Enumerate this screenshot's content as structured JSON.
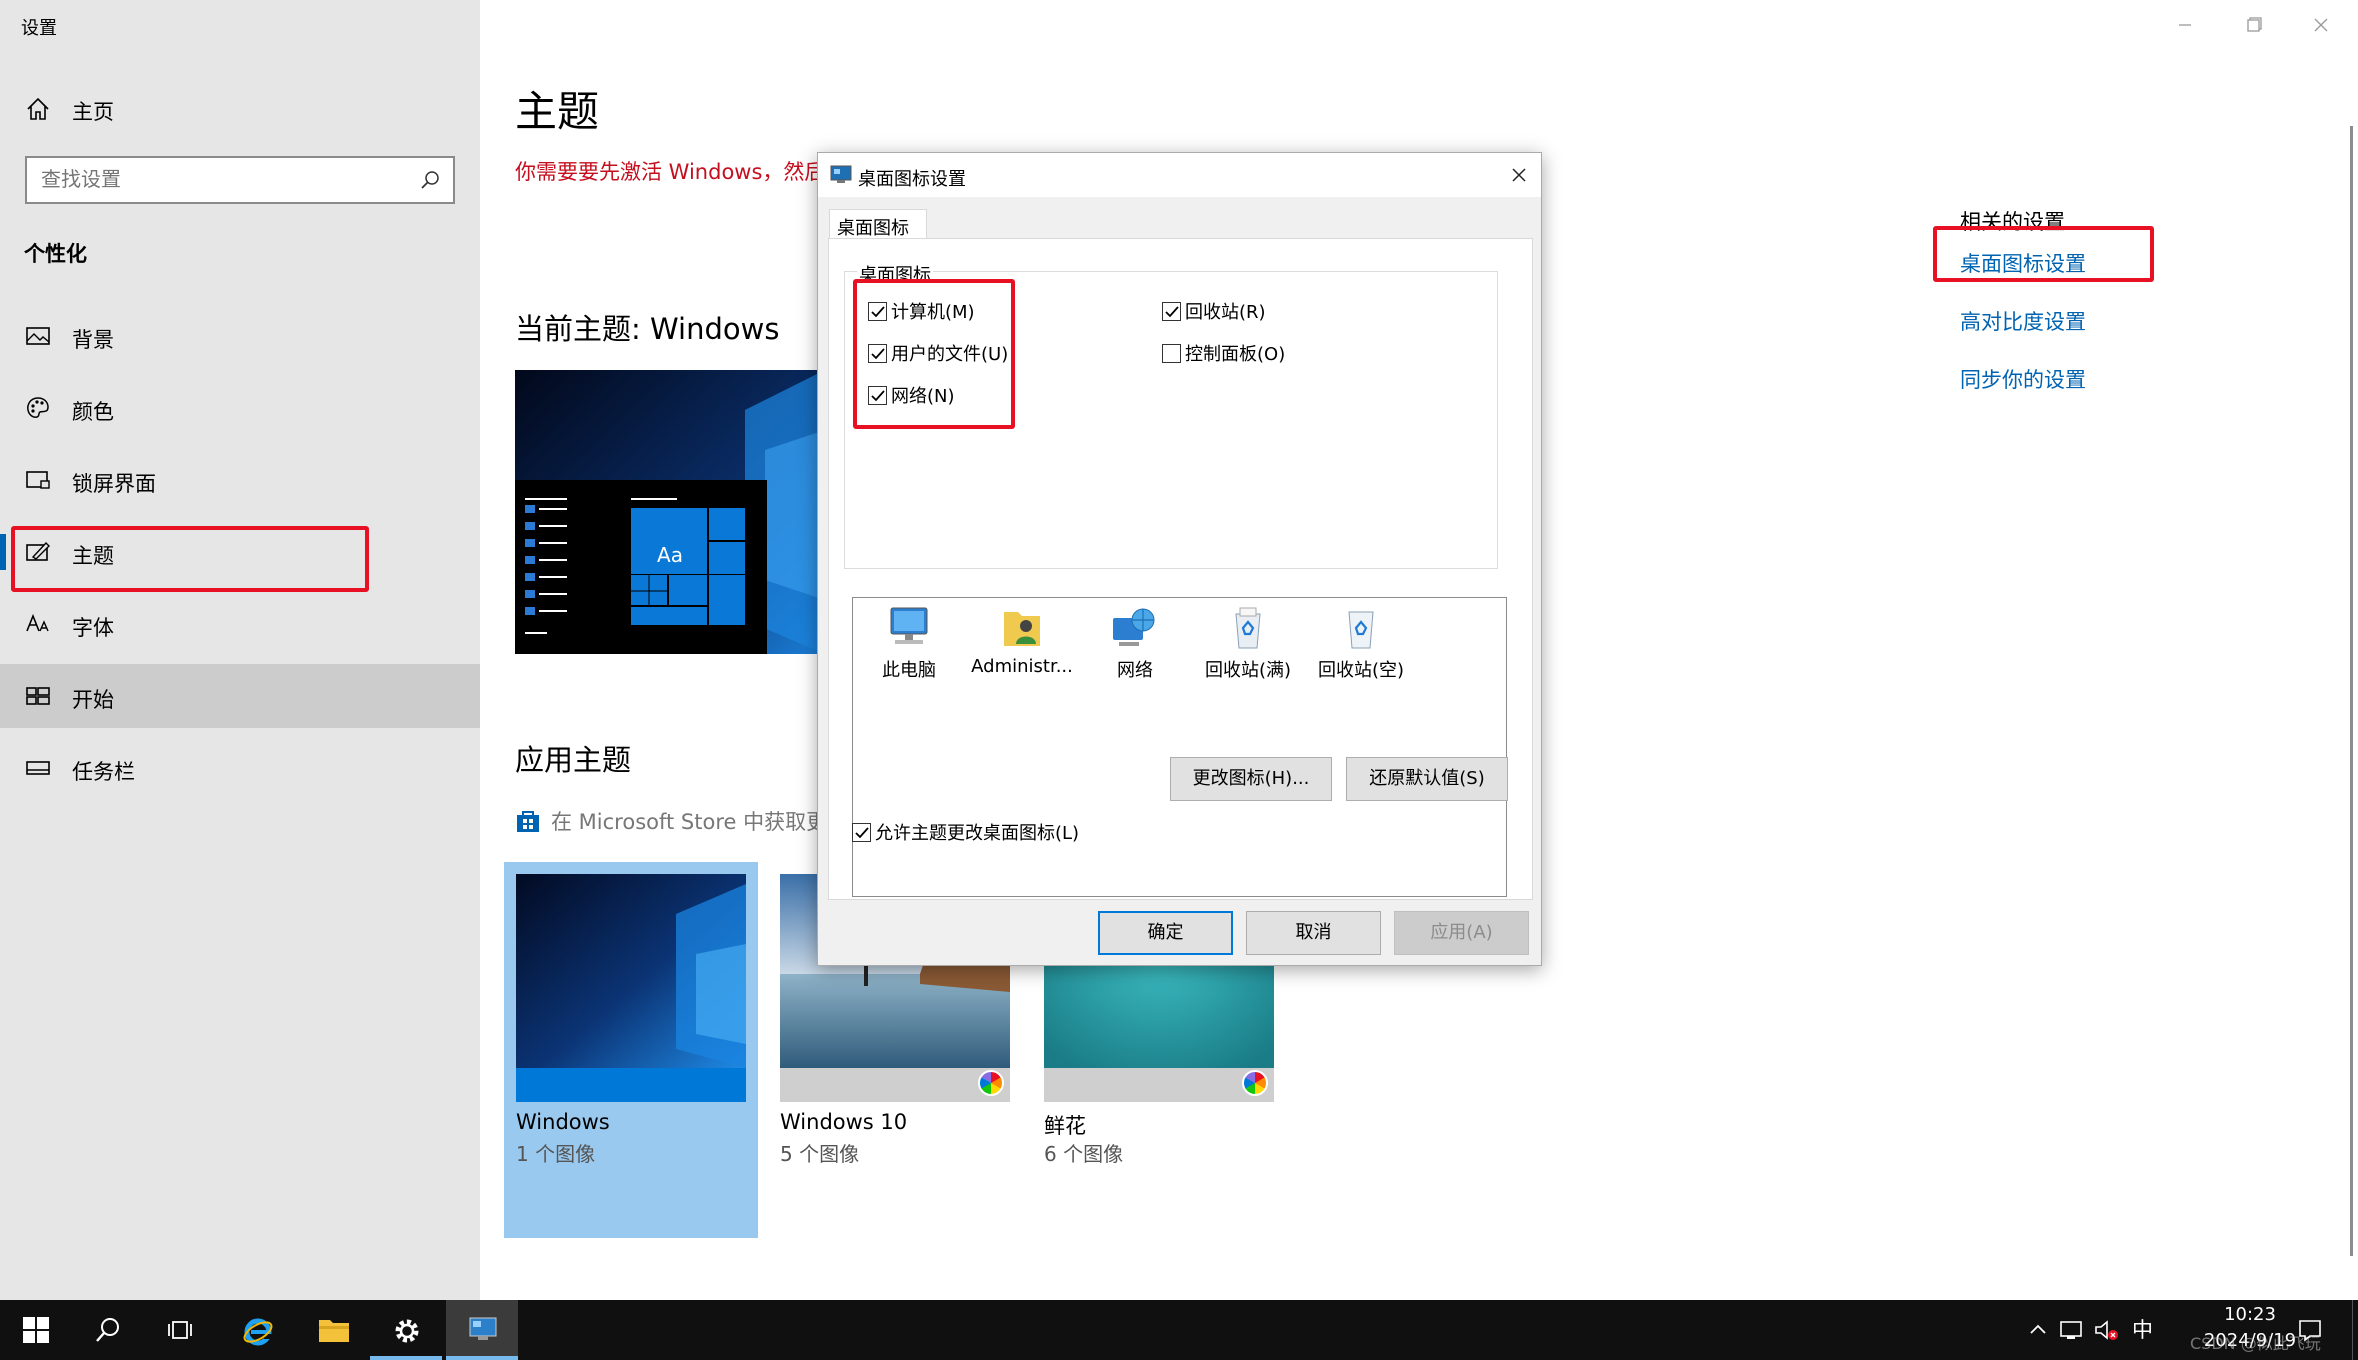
{
  "app": {
    "title": "设置"
  },
  "sidebar": {
    "home_label": "主页",
    "search_placeholder": "查找设置",
    "section_title": "个性化",
    "items": [
      {
        "label": "背景",
        "icon": "picture-icon"
      },
      {
        "label": "颜色",
        "icon": "palette-icon"
      },
      {
        "label": "锁屏界面",
        "icon": "lock-screen-icon"
      },
      {
        "label": "主题",
        "icon": "theme-brush-icon"
      },
      {
        "label": "字体",
        "icon": "font-icon"
      },
      {
        "label": "开始",
        "icon": "start-grid-icon"
      },
      {
        "label": "任务栏",
        "icon": "taskbar-icon"
      }
    ]
  },
  "main": {
    "title": "主题",
    "activation_msg": "你需要要先激活 Windows，然后才",
    "current_theme": "当前主题: Windows",
    "preview_text": "Aa",
    "apply_title": "应用主题",
    "store_link": "在 Microsoft Store 中获取更",
    "themes": [
      {
        "name": "Windows",
        "count": "1 个图像",
        "selected": true
      },
      {
        "name": "Windows 10",
        "count": "5 个图像",
        "selected": false
      },
      {
        "name": "鲜花",
        "count": "6 个图像",
        "selected": false
      }
    ]
  },
  "related": {
    "title": "相关的设置",
    "links": [
      "桌面图标设置",
      "高对比度设置",
      "同步你的设置"
    ]
  },
  "dialog": {
    "title": "桌面图标设置",
    "tab": "桌面图标",
    "group_label": "桌面图标",
    "checkboxes": [
      {
        "label": "计算机(M)",
        "checked": true
      },
      {
        "label": "用户的文件(U)",
        "checked": true
      },
      {
        "label": "网络(N)",
        "checked": true
      },
      {
        "label": "回收站(R)",
        "checked": true
      },
      {
        "label": "控制面板(O)",
        "checked": false
      }
    ],
    "icons": [
      "此电脑",
      "Administr...",
      "网络",
      "回收站(满)",
      "回收站(空)"
    ],
    "change_icon_button": "更改图标(H)...",
    "restore_default_button": "还原默认值(S)",
    "allow_themes_checkbox": {
      "label": "允许主题更改桌面图标(L)",
      "checked": true
    },
    "ok_button": "确定",
    "cancel_button": "取消",
    "apply_button": "应用(A)"
  },
  "taskbar": {
    "ime": "中",
    "time": "10:23",
    "date": "2024/9/19",
    "watermark": "CSDN @似此飞玩"
  },
  "colors": {
    "accent": "#0063b1",
    "highlight_box": "#e81123",
    "sidebar_bg": "#e6e6e6",
    "taskbar_bg": "#101010",
    "warning_text": "#c50f1f"
  }
}
